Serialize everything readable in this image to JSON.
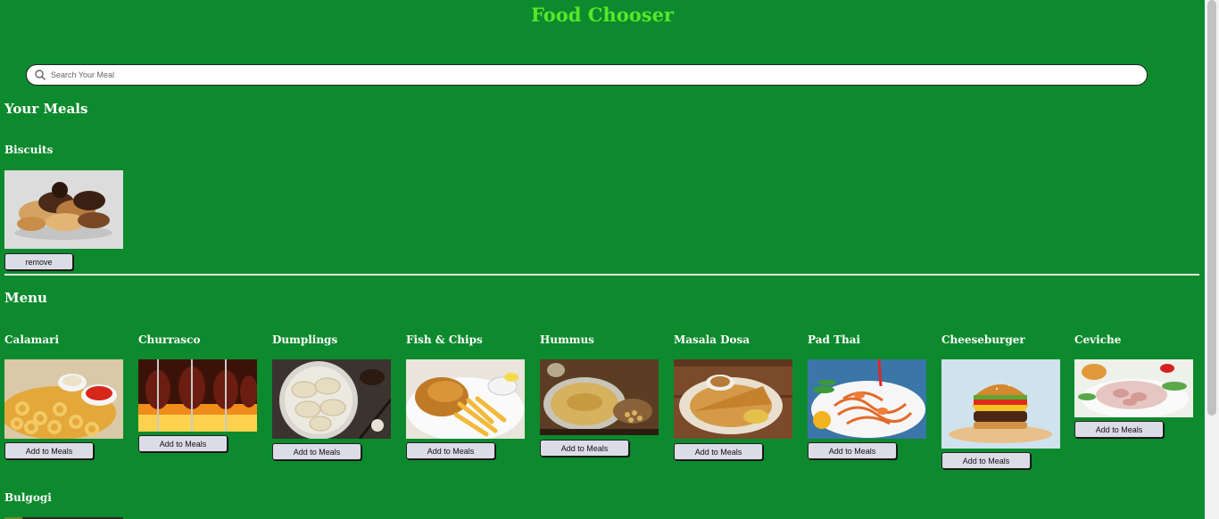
{
  "header": {
    "title": "Food Chooser"
  },
  "search": {
    "placeholder": "Search Your Meal",
    "value": ""
  },
  "your_meals": {
    "title": "Your Meals",
    "items": [
      {
        "name": "Biscuits",
        "button_label": "remove"
      }
    ]
  },
  "menu": {
    "title": "Menu",
    "button_label": "Add to Meals",
    "items": [
      {
        "name": "Calamari"
      },
      {
        "name": "Churrasco"
      },
      {
        "name": "Dumplings"
      },
      {
        "name": "Fish & Chips"
      },
      {
        "name": "Hummus"
      },
      {
        "name": "Masala Dosa"
      },
      {
        "name": "Pad Thai"
      },
      {
        "name": "Cheeseburger"
      },
      {
        "name": "Ceviche"
      },
      {
        "name": "Bulgogi"
      }
    ]
  },
  "colors": {
    "background": "#0d8a2d",
    "title": "#58e62a",
    "button": "#dcdce8"
  }
}
